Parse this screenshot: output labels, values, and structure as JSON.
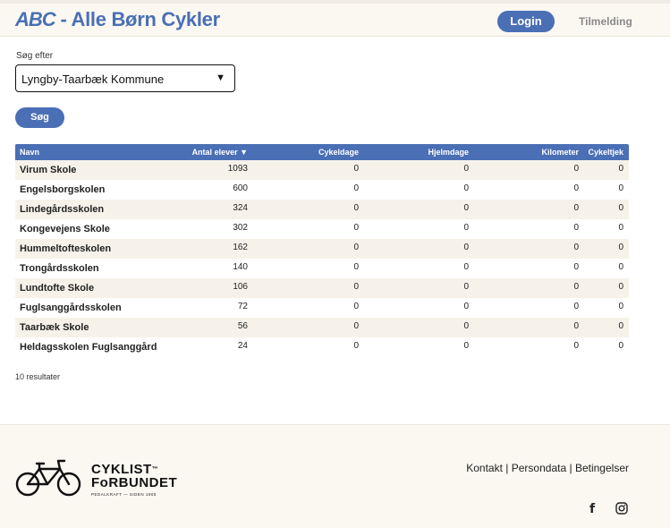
{
  "header": {
    "brand_abc": "ABC",
    "brand_rest": " - Alle Børn Cykler",
    "login_label": "Login",
    "signup_label": "Tilmelding",
    "accent_color": "#4a6fb5"
  },
  "search": {
    "label": "Søg efter",
    "selected_value": "Lyngby-Taarbæk Kommune",
    "button_label": "Søg"
  },
  "table": {
    "columns": {
      "name": "Navn",
      "students": "Antal elever ▼",
      "bike_days": "Cykeldage",
      "help_days": "Hjelmdage",
      "km": "Kilometer",
      "check": "Cykeltjek"
    },
    "rows": [
      {
        "name": "Virum Skole",
        "students": "1093",
        "bike_days": "0",
        "help_days": "0",
        "km": "0",
        "check": "0"
      },
      {
        "name": "Engelsborgskolen",
        "students": "600",
        "bike_days": "0",
        "help_days": "0",
        "km": "0",
        "check": "0"
      },
      {
        "name": "Lindegårdsskolen",
        "students": "324",
        "bike_days": "0",
        "help_days": "0",
        "km": "0",
        "check": "0"
      },
      {
        "name": "Kongevejens Skole",
        "students": "302",
        "bike_days": "0",
        "help_days": "0",
        "km": "0",
        "check": "0"
      },
      {
        "name": "Hummeltofteskolen",
        "students": "162",
        "bike_days": "0",
        "help_days": "0",
        "km": "0",
        "check": "0"
      },
      {
        "name": "Trongårdsskolen",
        "students": "140",
        "bike_days": "0",
        "help_days": "0",
        "km": "0",
        "check": "0"
      },
      {
        "name": "Lundtofte Skole",
        "students": "106",
        "bike_days": "0",
        "help_days": "0",
        "km": "0",
        "check": "0"
      },
      {
        "name": "Fuglsanggårdsskolen",
        "students": "72",
        "bike_days": "0",
        "help_days": "0",
        "km": "0",
        "check": "0"
      },
      {
        "name": "Taarbæk Skole",
        "students": "56",
        "bike_days": "0",
        "help_days": "0",
        "km": "0",
        "check": "0"
      },
      {
        "name": "Heldagsskolen Fuglsanggård",
        "students": "24",
        "bike_days": "0",
        "help_days": "0",
        "km": "0",
        "check": "0"
      }
    ],
    "result_count": "10 resultater"
  },
  "footer": {
    "logo_line1": "CYKLIST",
    "logo_tm": "™",
    "logo_line2": "FoRBUNDET",
    "logo_tagline": "PEDALKRAFT — SIDEN 1905",
    "links": {
      "contact": "Kontakt",
      "personal_data": "Persondata",
      "terms": "Betingelser",
      "separator": "|"
    },
    "social_icons": [
      "facebook-icon",
      "instagram-icon"
    ]
  }
}
